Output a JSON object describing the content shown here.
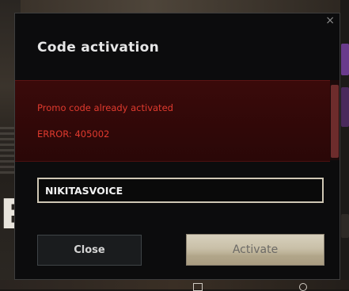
{
  "modal": {
    "title": "Code activation",
    "close_glyph": "×",
    "error": {
      "message": "Promo code already activated",
      "code": "ERROR: 405002"
    },
    "input": {
      "value": "NIKITASVOICE"
    },
    "buttons": {
      "close_label": "Close",
      "activate_label": "Activate"
    }
  },
  "background": {
    "left_letter": "E"
  },
  "colors": {
    "error_text": "#e03a2e",
    "error_panel": "#3a0a0a",
    "modal_bg": "#0c0c0d",
    "activate_button": "#d7d0bd",
    "input_border": "#cfc7b4"
  }
}
